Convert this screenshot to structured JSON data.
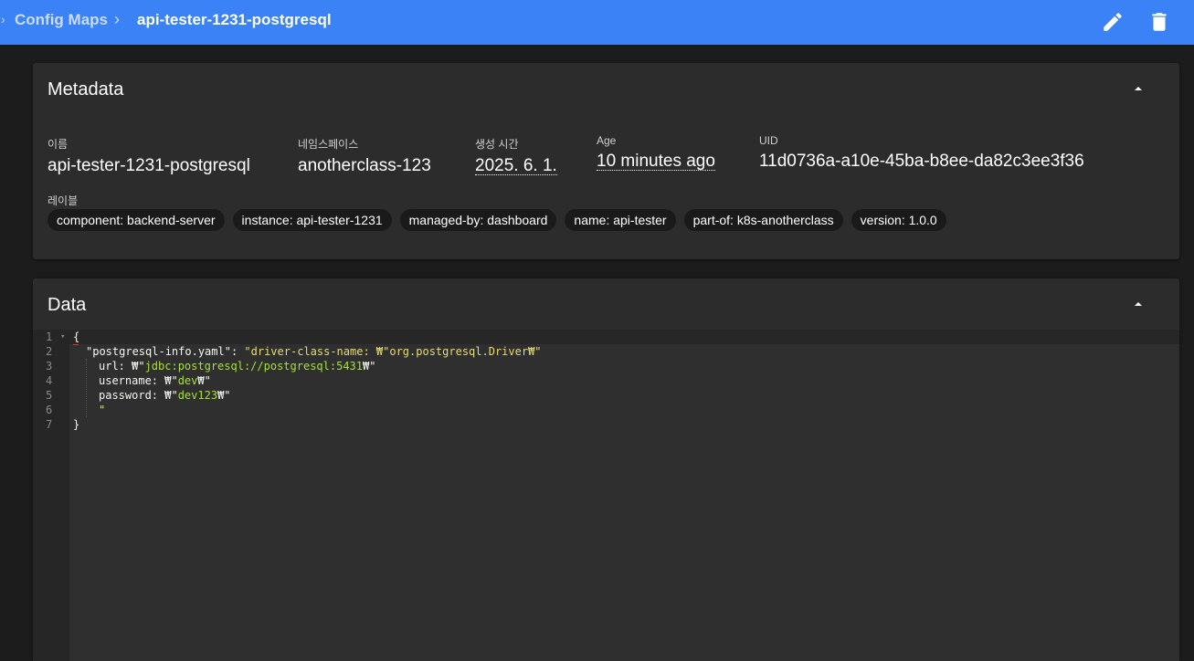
{
  "breadcrumb": {
    "parent": "Config Maps",
    "separator": "›",
    "current": "api-tester-1231-postgresql"
  },
  "toolbar": {
    "edit_icon": "pencil-icon",
    "delete_icon": "trash-icon"
  },
  "metadata": {
    "title": "Metadata",
    "fields": {
      "name": {
        "label": "이름",
        "value": "api-tester-1231-postgresql"
      },
      "namespace": {
        "label": "네임스페이스",
        "value": "anotherclass-123"
      },
      "created": {
        "label": "생성 시간",
        "value": "2025. 6. 1."
      },
      "age": {
        "label": "Age",
        "value": "10 minutes ago"
      },
      "uid": {
        "label": "UID",
        "value": "11d0736a-a10e-45ba-b8ee-da82c3ee3f36"
      }
    },
    "labels_title": "레이블",
    "labels": [
      "component: backend-server",
      "instance: api-tester-1231",
      "managed-by: dashboard",
      "name: api-tester",
      "part-of: k8s-anotherclass",
      "version: 1.0.0"
    ]
  },
  "data": {
    "title": "Data",
    "line_numbers": [
      "1",
      "2",
      "3",
      "4",
      "5",
      "6",
      "7"
    ],
    "code": {
      "l1": "{",
      "l2_key": "\"postgresql-info.yaml\"",
      "l2_colon": ": ",
      "l2_val": "\"driver-class-name: ₩\"org.postgresql.Driver₩\"",
      "l3_pre": "url: ₩\"",
      "l3_val": "jdbc:postgresql://postgresql:5431",
      "l3_post": "₩\"",
      "l4_pre": "username: ₩\"",
      "l4_val": "dev",
      "l4_post": "₩\"",
      "l5_pre": "password: ₩\"",
      "l5_val": "dev123",
      "l5_post": "₩\"",
      "l6": "\"",
      "l7": "}"
    }
  },
  "colors": {
    "topbar": "#3a82f6",
    "background": "#1c1c1c",
    "card": "#2c2c2c",
    "chip": "#1a1a1a",
    "string": "#e6db74",
    "url_value": "#a6e22e"
  }
}
